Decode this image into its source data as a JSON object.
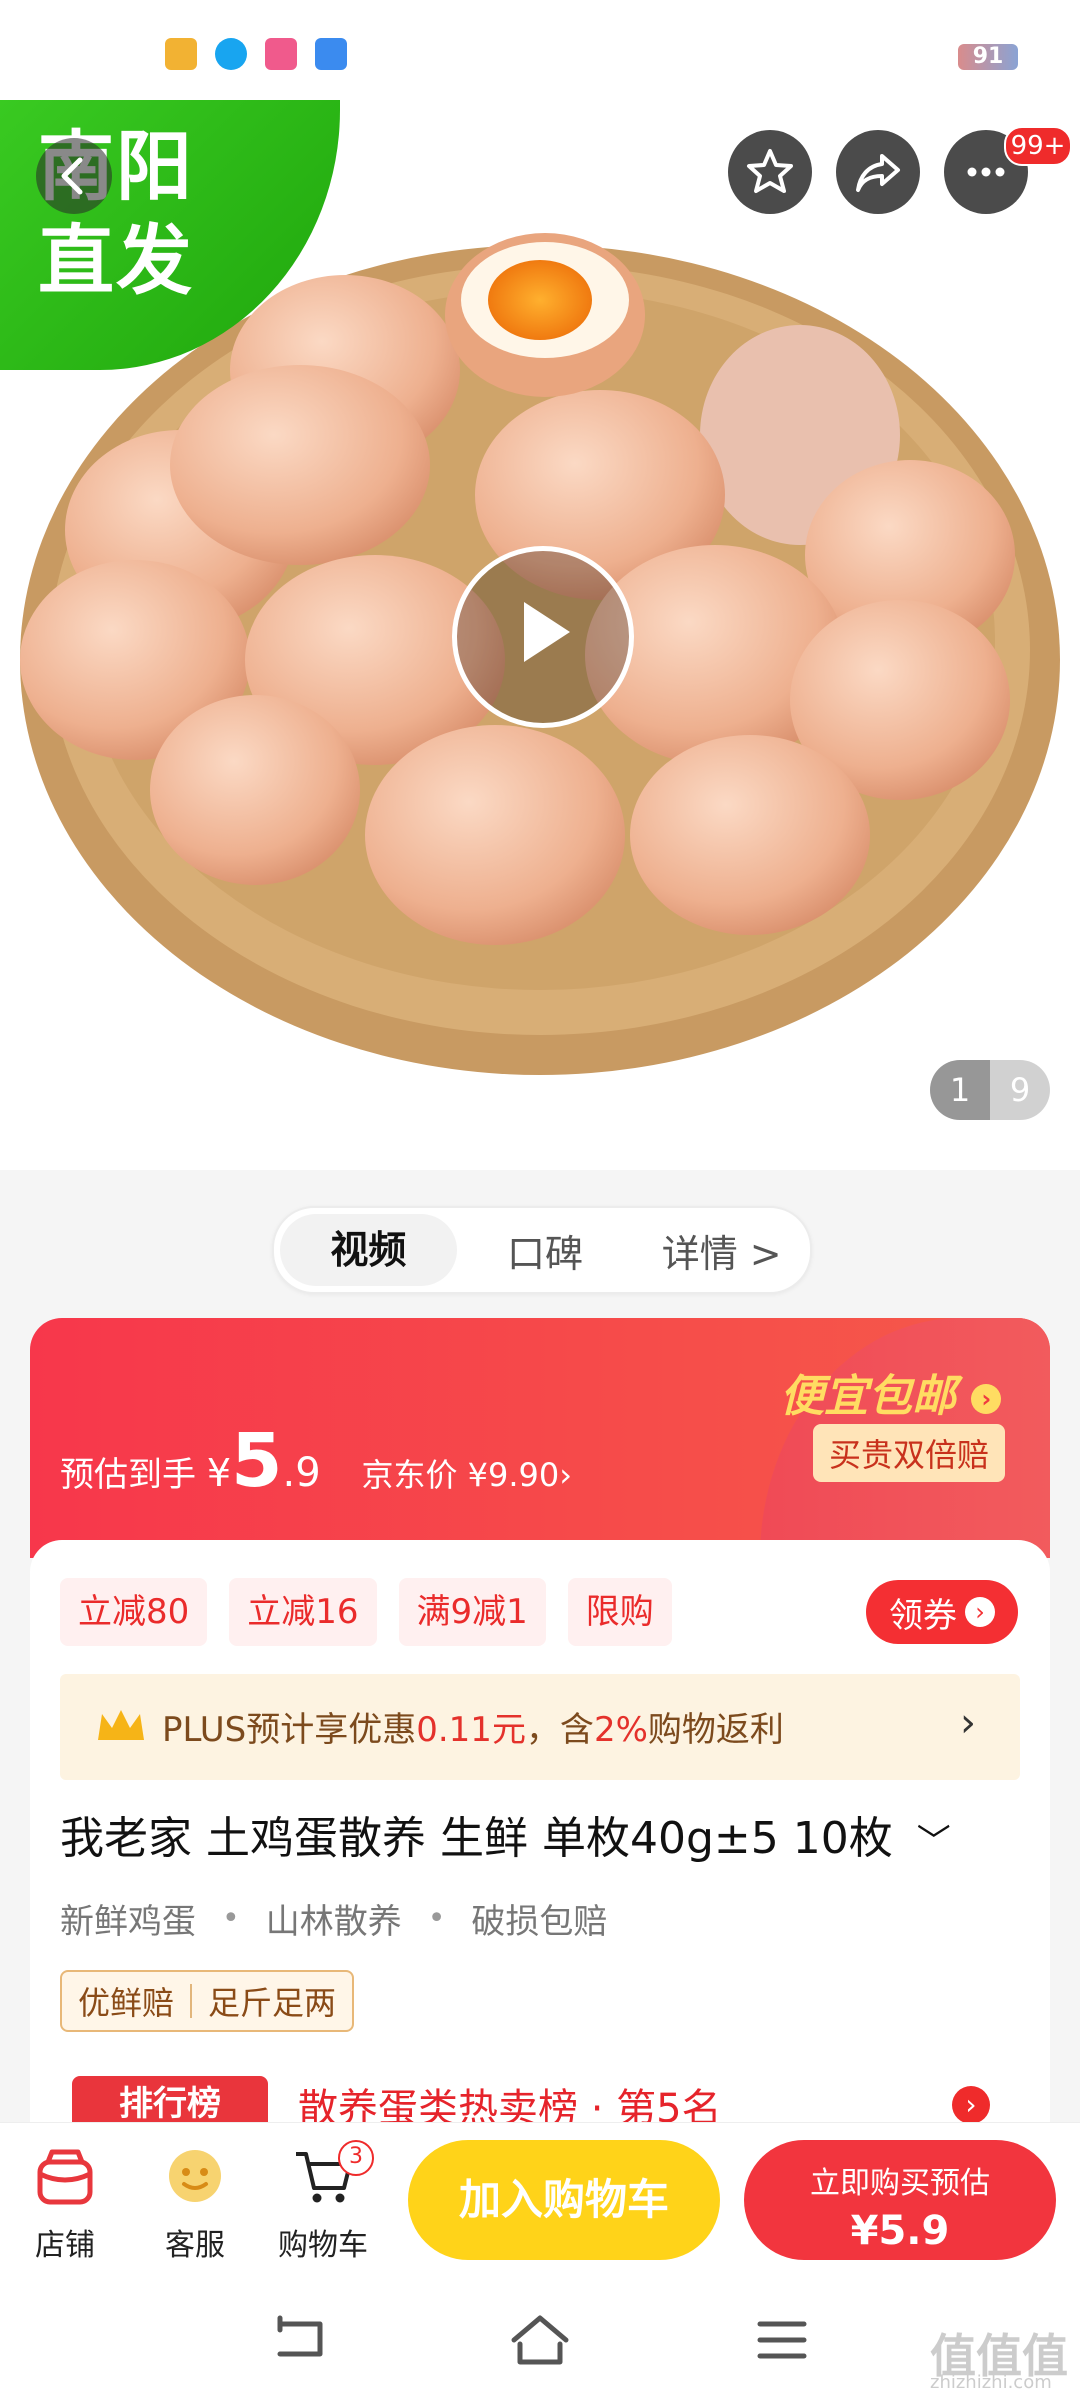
{
  "status_bar": {
    "battery": "91"
  },
  "hero": {
    "banner_text_line1": "南阳",
    "banner_text_line2": "直发",
    "notification_badge": "99+",
    "image_counter_current": "1",
    "image_counter_total": "9"
  },
  "tabs": [
    {
      "label": "视频"
    },
    {
      "label": "口碑"
    },
    {
      "label": "详情 >"
    }
  ],
  "price": {
    "estimate_label": "预估到手",
    "currency": "¥",
    "integer": "5",
    "decimal": ".9",
    "jd_price": "京东价 ¥9.90›",
    "free_shipping": "便宜包邮",
    "double_refund": "买贵双倍赔"
  },
  "promo_tags": [
    "立减80",
    "立减16",
    "满9减1",
    "限购"
  ],
  "coupon_label": "领券",
  "plus": {
    "text_prefix": "PLUS预计享优惠",
    "amount": "0.11元",
    "text_mid": "，含",
    "percent": "2%",
    "text_suffix": "购物返利"
  },
  "product": {
    "title": "我老家 土鸡蛋散养 生鲜 单枚40g±5 10枚",
    "features": [
      "新鲜鸡蛋",
      "山林散养",
      "破损包赔"
    ],
    "guarantees": [
      "优鲜赔",
      "足斤足两"
    ]
  },
  "ranking": {
    "logo_label": "排行榜",
    "text": "散养蛋类热卖榜 · 第5名"
  },
  "bottom_bar": {
    "store_label": "店铺",
    "service_label": "客服",
    "cart_label": "购物车",
    "cart_count": "3",
    "add_cart_label": "加入购物车",
    "buy_now_label": "立即购买预估",
    "buy_now_price": "¥5.9"
  },
  "watermark": {
    "main": "值值值",
    "sub": "zhizhizhi.com"
  },
  "colors": {
    "accent_red": "#f2353e",
    "cart_yellow": "#ffd319",
    "banner_green": "#2fbf18"
  }
}
